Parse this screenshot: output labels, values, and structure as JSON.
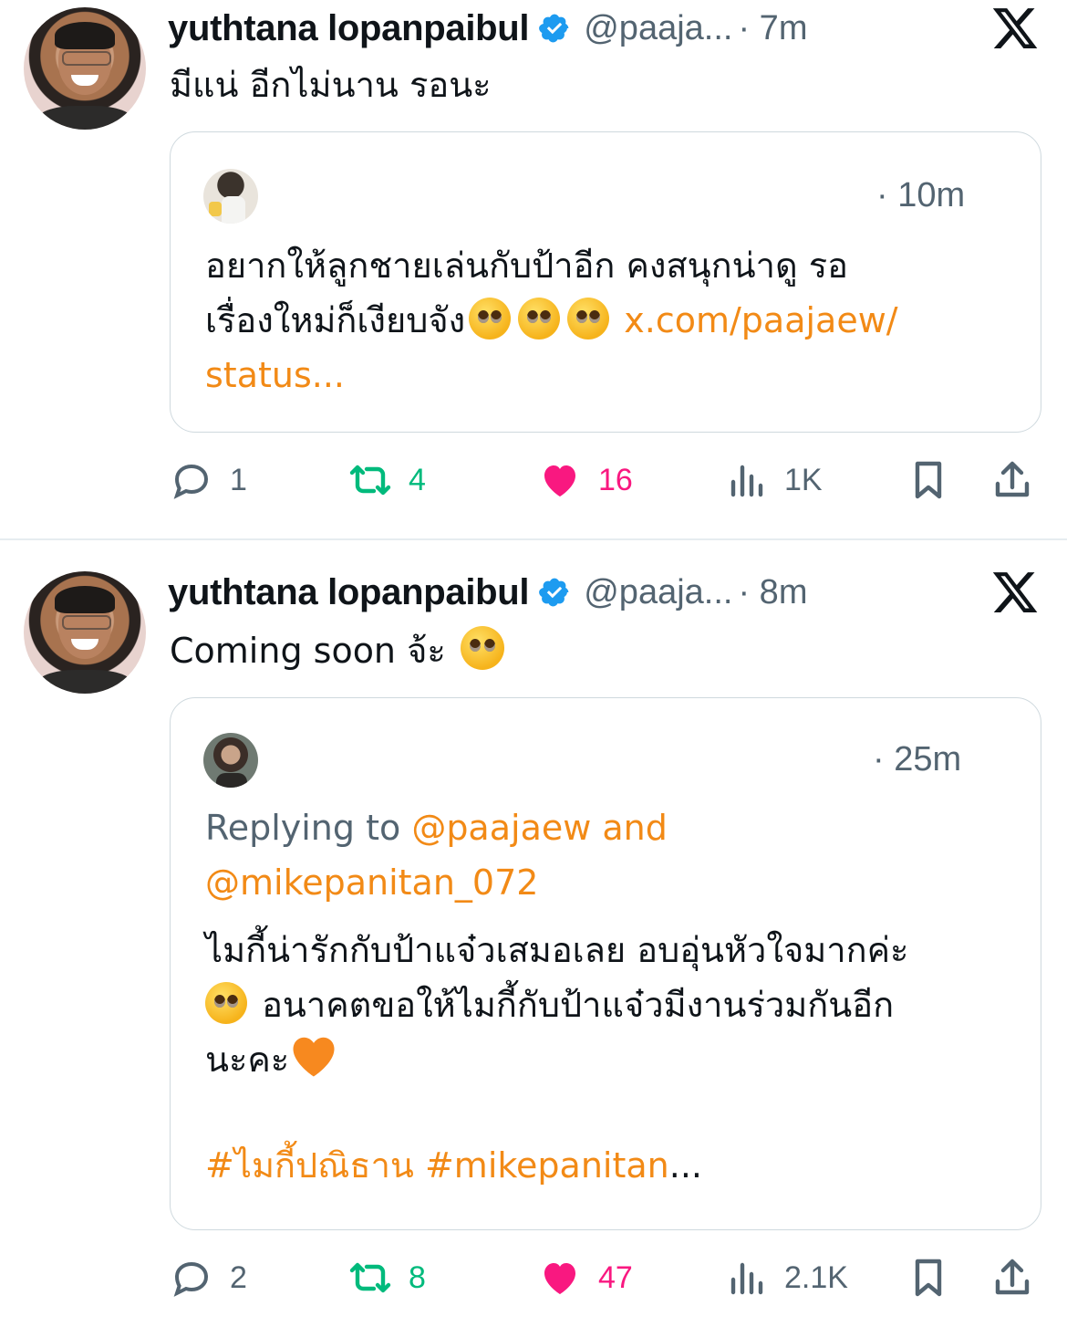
{
  "tweets": [
    {
      "author_name": "yuthtana lopanpaibul",
      "handle": "@paaja...",
      "time": "· 7m",
      "text": "มีแน่ อีกไม่นาน รอนะ",
      "quote": {
        "time": "· 10m",
        "text_line1": "อยากให้ลูกชายเล่นกับป้าอีก คงสนุกน่าดู  รอ",
        "text_line2": "เรื่องใหม่ก็เงียบจัง",
        "link1": "x.com/paajaew/",
        "link2": "status..."
      },
      "actions": {
        "replies": "1",
        "reposts": "4",
        "likes": "16",
        "views": "1K"
      }
    },
    {
      "author_name": "yuthtana lopanpaibul",
      "handle": "@paaja...",
      "time": "· 8m",
      "text": "Coming soon จ้ะ",
      "quote": {
        "time": "· 25m",
        "replying_prefix": "Replying to ",
        "mention1": "@paajaew and",
        "mention2": "@mikepanitan_072",
        "line1": "ไมกี้น่ารักกับป้าแจ๋วเสมอเลย อบอุ่นหัวใจมากค่ะ",
        "line2": "อนาคตขอให้ไมกี้กับป้าแจ๋วมีงานร่วมกันอีก",
        "line3": "นะคะ",
        "hashtags": "#ไมกี้ปณิธาน #mikepanitan",
        "ellipsis": "..."
      },
      "actions": {
        "replies": "2",
        "reposts": "8",
        "likes": "47",
        "views": "2.1K"
      }
    }
  ],
  "colors": {
    "link": "#f28a16",
    "repost": "#00ba7c",
    "like": "#f91880",
    "muted": "#536471",
    "verified": "#1d9bf0"
  },
  "icons": [
    "verified-badge-icon",
    "x-logo-icon",
    "reply-icon",
    "repost-icon",
    "heart-icon",
    "views-icon",
    "bookmark-icon",
    "share-icon"
  ]
}
